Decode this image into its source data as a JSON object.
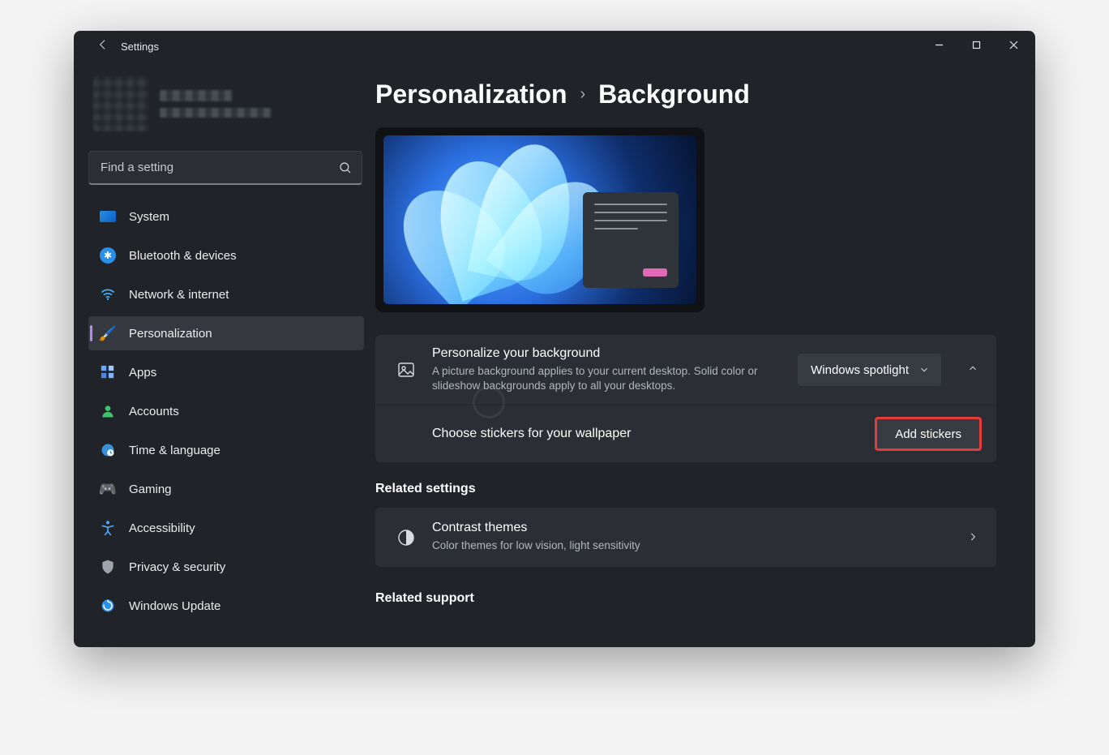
{
  "window": {
    "title": "Settings"
  },
  "search": {
    "placeholder": "Find a setting"
  },
  "sidebar": {
    "items": [
      {
        "icon": "🖥️",
        "label": "System"
      },
      {
        "icon": "bt",
        "label": "Bluetooth & devices"
      },
      {
        "icon": "wifi",
        "label": "Network & internet"
      },
      {
        "icon": "🖌️",
        "label": "Personalization"
      },
      {
        "icon": "apps",
        "label": "Apps"
      },
      {
        "icon": "👤",
        "label": "Accounts"
      },
      {
        "icon": "🌐",
        "label": "Time & language"
      },
      {
        "icon": "🎮",
        "label": "Gaming"
      },
      {
        "icon": "a11y",
        "label": "Accessibility"
      },
      {
        "icon": "🛡️",
        "label": "Privacy & security"
      },
      {
        "icon": "🔄",
        "label": "Windows Update"
      }
    ]
  },
  "breadcrumb": {
    "parent": "Personalization",
    "current": "Background"
  },
  "personalize": {
    "title": "Personalize your background",
    "subtitle": "A picture background applies to your current desktop. Solid color or slideshow backgrounds apply to all your desktops.",
    "dropdown_value": "Windows spotlight"
  },
  "stickers": {
    "label": "Choose stickers for your wallpaper",
    "button": "Add stickers"
  },
  "related_settings": {
    "heading": "Related settings",
    "contrast_title": "Contrast themes",
    "contrast_sub": "Color themes for low vision, light sensitivity"
  },
  "related_support": {
    "heading": "Related support"
  }
}
